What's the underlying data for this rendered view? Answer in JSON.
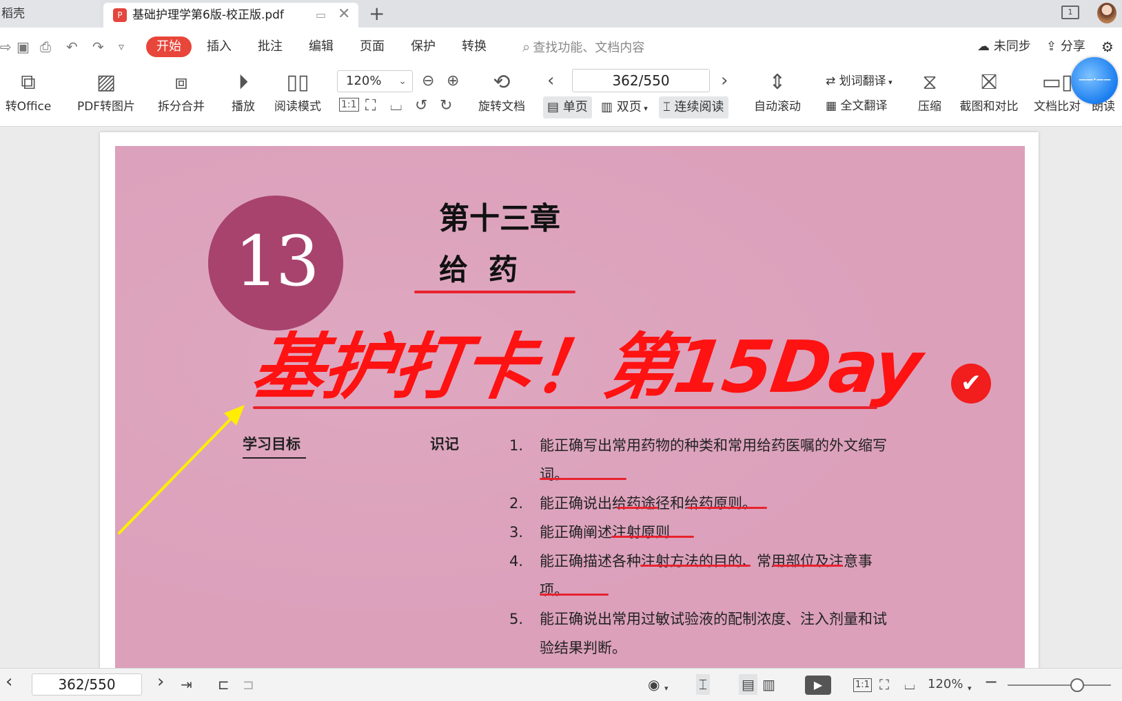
{
  "tabs": {
    "home_label": "稻壳",
    "doc_title": "基础护理学第6版-校正版.pdf",
    "add_label": "+",
    "close_label": "✕",
    "window_count": "1"
  },
  "menu": {
    "start": "开始",
    "items": [
      "插入",
      "批注",
      "编辑",
      "页面",
      "保护",
      "转换"
    ],
    "search_placeholder": "查找功能、文档内容",
    "sync": "未同步",
    "share": "分享"
  },
  "ribbon": {
    "to_office": "转Office",
    "pdf_to_image": "PDF转图片",
    "split_merge": "拆分合并",
    "play": "播放",
    "read_mode": "阅读模式",
    "zoom": "120%",
    "rotate_doc": "旋转文档",
    "page_indicator": "362/550",
    "single_page": "单页",
    "double_page": "双页",
    "continuous": "连续阅读",
    "auto_scroll": "自动滚动",
    "word_translate": "划词翻译",
    "full_translate": "全文翻译",
    "compress": "压缩",
    "screenshot_compare": "截图和对比",
    "doc_compare": "文档比对",
    "read_aloud": "朗读",
    "one_to_one": "1:1"
  },
  "document": {
    "chapter_number": "13",
    "chapter_title": "第十三章",
    "chapter_name": "给药",
    "stamp_text": "基护打卡！第15Day",
    "goal_label": "学习目标",
    "recall_label": "识记",
    "goals": [
      {
        "num": "1.",
        "text": "能正确写出常用药物的种类和常用给药医嘱的外文缩写词。"
      },
      {
        "num": "2.",
        "text": "能正确说出给药途径和给药原则。"
      },
      {
        "num": "3.",
        "text": "能正确阐述注射原则"
      },
      {
        "num": "4.",
        "text": "能正确描述各种注射方法的目的、常用部位及注意事项。"
      },
      {
        "num": "5.",
        "text": "能正确说出常用过敏试验液的配制浓度、注入剂量和试验结果判断。"
      }
    ]
  },
  "statusbar": {
    "page_indicator": "362/550",
    "zoom": "120%",
    "one_to_one": "1:1"
  },
  "colors": {
    "accent_red": "#e8463a",
    "scan_pink": "#dca0bb",
    "chapter_circle": "#a8436e",
    "stamp_red": "#ff1212",
    "arrow_yellow": "#ffee00"
  }
}
